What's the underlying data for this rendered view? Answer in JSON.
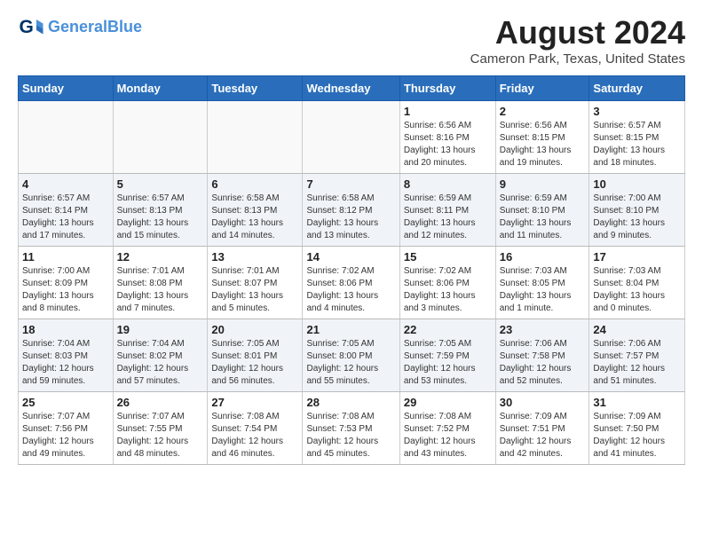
{
  "header": {
    "logo_line1": "General",
    "logo_line2": "Blue",
    "title": "August 2024",
    "subtitle": "Cameron Park, Texas, United States"
  },
  "days_of_week": [
    "Sunday",
    "Monday",
    "Tuesday",
    "Wednesday",
    "Thursday",
    "Friday",
    "Saturday"
  ],
  "weeks": [
    [
      {
        "day": "",
        "info": ""
      },
      {
        "day": "",
        "info": ""
      },
      {
        "day": "",
        "info": ""
      },
      {
        "day": "",
        "info": ""
      },
      {
        "day": "1",
        "info": "Sunrise: 6:56 AM\nSunset: 8:16 PM\nDaylight: 13 hours\nand 20 minutes."
      },
      {
        "day": "2",
        "info": "Sunrise: 6:56 AM\nSunset: 8:15 PM\nDaylight: 13 hours\nand 19 minutes."
      },
      {
        "day": "3",
        "info": "Sunrise: 6:57 AM\nSunset: 8:15 PM\nDaylight: 13 hours\nand 18 minutes."
      }
    ],
    [
      {
        "day": "4",
        "info": "Sunrise: 6:57 AM\nSunset: 8:14 PM\nDaylight: 13 hours\nand 17 minutes."
      },
      {
        "day": "5",
        "info": "Sunrise: 6:57 AM\nSunset: 8:13 PM\nDaylight: 13 hours\nand 15 minutes."
      },
      {
        "day": "6",
        "info": "Sunrise: 6:58 AM\nSunset: 8:13 PM\nDaylight: 13 hours\nand 14 minutes."
      },
      {
        "day": "7",
        "info": "Sunrise: 6:58 AM\nSunset: 8:12 PM\nDaylight: 13 hours\nand 13 minutes."
      },
      {
        "day": "8",
        "info": "Sunrise: 6:59 AM\nSunset: 8:11 PM\nDaylight: 13 hours\nand 12 minutes."
      },
      {
        "day": "9",
        "info": "Sunrise: 6:59 AM\nSunset: 8:10 PM\nDaylight: 13 hours\nand 11 minutes."
      },
      {
        "day": "10",
        "info": "Sunrise: 7:00 AM\nSunset: 8:10 PM\nDaylight: 13 hours\nand 9 minutes."
      }
    ],
    [
      {
        "day": "11",
        "info": "Sunrise: 7:00 AM\nSunset: 8:09 PM\nDaylight: 13 hours\nand 8 minutes."
      },
      {
        "day": "12",
        "info": "Sunrise: 7:01 AM\nSunset: 8:08 PM\nDaylight: 13 hours\nand 7 minutes."
      },
      {
        "day": "13",
        "info": "Sunrise: 7:01 AM\nSunset: 8:07 PM\nDaylight: 13 hours\nand 5 minutes."
      },
      {
        "day": "14",
        "info": "Sunrise: 7:02 AM\nSunset: 8:06 PM\nDaylight: 13 hours\nand 4 minutes."
      },
      {
        "day": "15",
        "info": "Sunrise: 7:02 AM\nSunset: 8:06 PM\nDaylight: 13 hours\nand 3 minutes."
      },
      {
        "day": "16",
        "info": "Sunrise: 7:03 AM\nSunset: 8:05 PM\nDaylight: 13 hours\nand 1 minute."
      },
      {
        "day": "17",
        "info": "Sunrise: 7:03 AM\nSunset: 8:04 PM\nDaylight: 13 hours\nand 0 minutes."
      }
    ],
    [
      {
        "day": "18",
        "info": "Sunrise: 7:04 AM\nSunset: 8:03 PM\nDaylight: 12 hours\nand 59 minutes."
      },
      {
        "day": "19",
        "info": "Sunrise: 7:04 AM\nSunset: 8:02 PM\nDaylight: 12 hours\nand 57 minutes."
      },
      {
        "day": "20",
        "info": "Sunrise: 7:05 AM\nSunset: 8:01 PM\nDaylight: 12 hours\nand 56 minutes."
      },
      {
        "day": "21",
        "info": "Sunrise: 7:05 AM\nSunset: 8:00 PM\nDaylight: 12 hours\nand 55 minutes."
      },
      {
        "day": "22",
        "info": "Sunrise: 7:05 AM\nSunset: 7:59 PM\nDaylight: 12 hours\nand 53 minutes."
      },
      {
        "day": "23",
        "info": "Sunrise: 7:06 AM\nSunset: 7:58 PM\nDaylight: 12 hours\nand 52 minutes."
      },
      {
        "day": "24",
        "info": "Sunrise: 7:06 AM\nSunset: 7:57 PM\nDaylight: 12 hours\nand 51 minutes."
      }
    ],
    [
      {
        "day": "25",
        "info": "Sunrise: 7:07 AM\nSunset: 7:56 PM\nDaylight: 12 hours\nand 49 minutes."
      },
      {
        "day": "26",
        "info": "Sunrise: 7:07 AM\nSunset: 7:55 PM\nDaylight: 12 hours\nand 48 minutes."
      },
      {
        "day": "27",
        "info": "Sunrise: 7:08 AM\nSunset: 7:54 PM\nDaylight: 12 hours\nand 46 minutes."
      },
      {
        "day": "28",
        "info": "Sunrise: 7:08 AM\nSunset: 7:53 PM\nDaylight: 12 hours\nand 45 minutes."
      },
      {
        "day": "29",
        "info": "Sunrise: 7:08 AM\nSunset: 7:52 PM\nDaylight: 12 hours\nand 43 minutes."
      },
      {
        "day": "30",
        "info": "Sunrise: 7:09 AM\nSunset: 7:51 PM\nDaylight: 12 hours\nand 42 minutes."
      },
      {
        "day": "31",
        "info": "Sunrise: 7:09 AM\nSunset: 7:50 PM\nDaylight: 12 hours\nand 41 minutes."
      }
    ]
  ]
}
